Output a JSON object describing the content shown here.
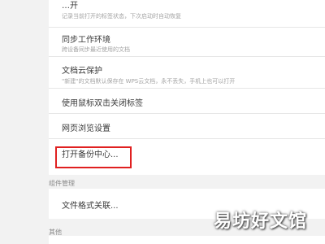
{
  "settings": {
    "top_item": {
      "title": "…开",
      "desc": "记录当前打开的标签状态，下次启动时自动恢复"
    },
    "sync_workspace": {
      "title": "同步工作环境",
      "desc": "跨设备同步最近使用的文档"
    },
    "doc_cloud": {
      "title": "文档云保护",
      "desc": "\"新建\"的文档默认保存在 WPS云文档，永不丢失，手机上也可以打开"
    },
    "dblclick_close": {
      "title": "使用鼠标双击关闭标签"
    },
    "web_browse": {
      "title": "网页浏览设置"
    },
    "backup_center": {
      "title": "打开备份中心..."
    }
  },
  "sections": {
    "component_mgmt": {
      "label": "组件管理",
      "items": [
        {
          "title": "文件格式关联..."
        }
      ]
    },
    "other": {
      "label": "其他"
    }
  },
  "watermark": "易坊好文馆",
  "colors": {
    "background": "#f2f2f2",
    "card": "#ffffff",
    "highlight": "#e02020"
  }
}
